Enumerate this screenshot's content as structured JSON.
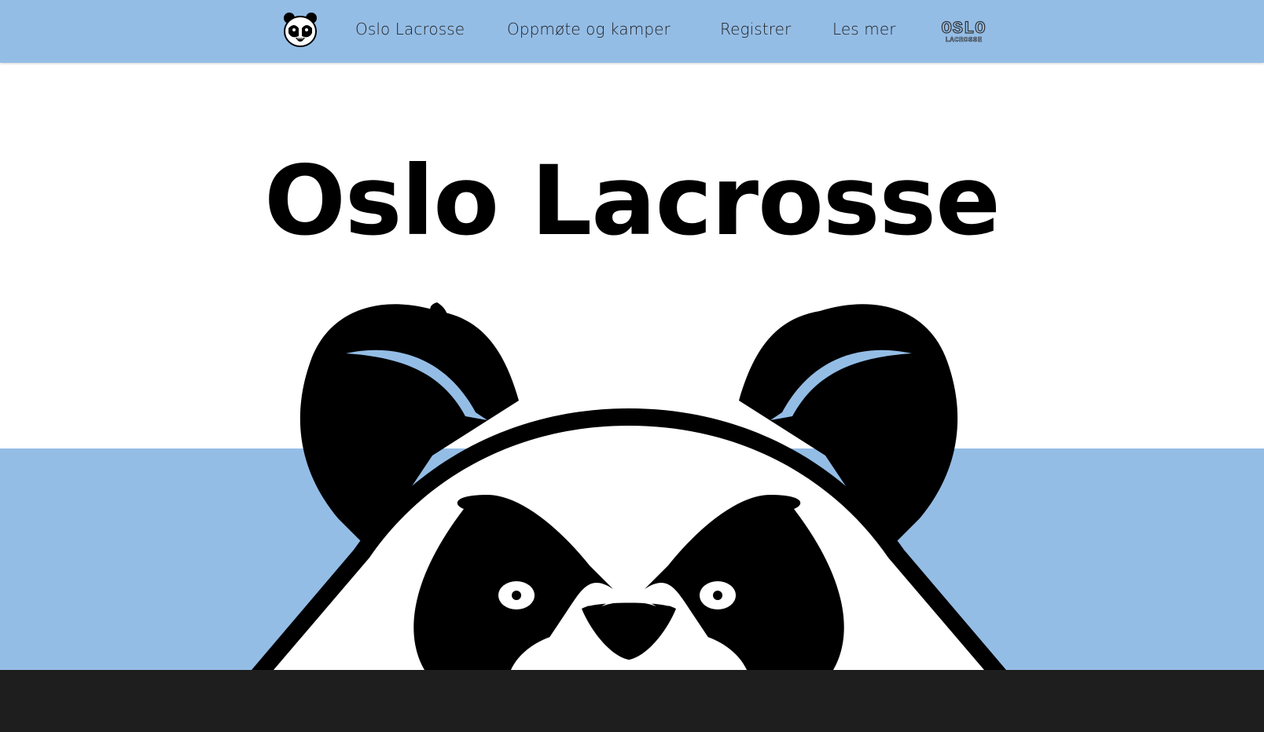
{
  "nav": {
    "logo_icon": "panda-logo-icon",
    "links": [
      {
        "label": "Oslo Lacrosse"
      },
      {
        "label": "Oppmøte og kamper"
      },
      {
        "label": "Registrer"
      },
      {
        "label": "Les mer"
      }
    ],
    "wordmark": {
      "line1": "OSLO",
      "line2": "LACROSSE"
    }
  },
  "hero": {
    "title": "Oslo Lacrosse",
    "illustration_icon": "panda-face-icon"
  },
  "colors": {
    "brand_blue": "#94bde6",
    "footer": "#1e1e1e",
    "text": "#000000"
  }
}
